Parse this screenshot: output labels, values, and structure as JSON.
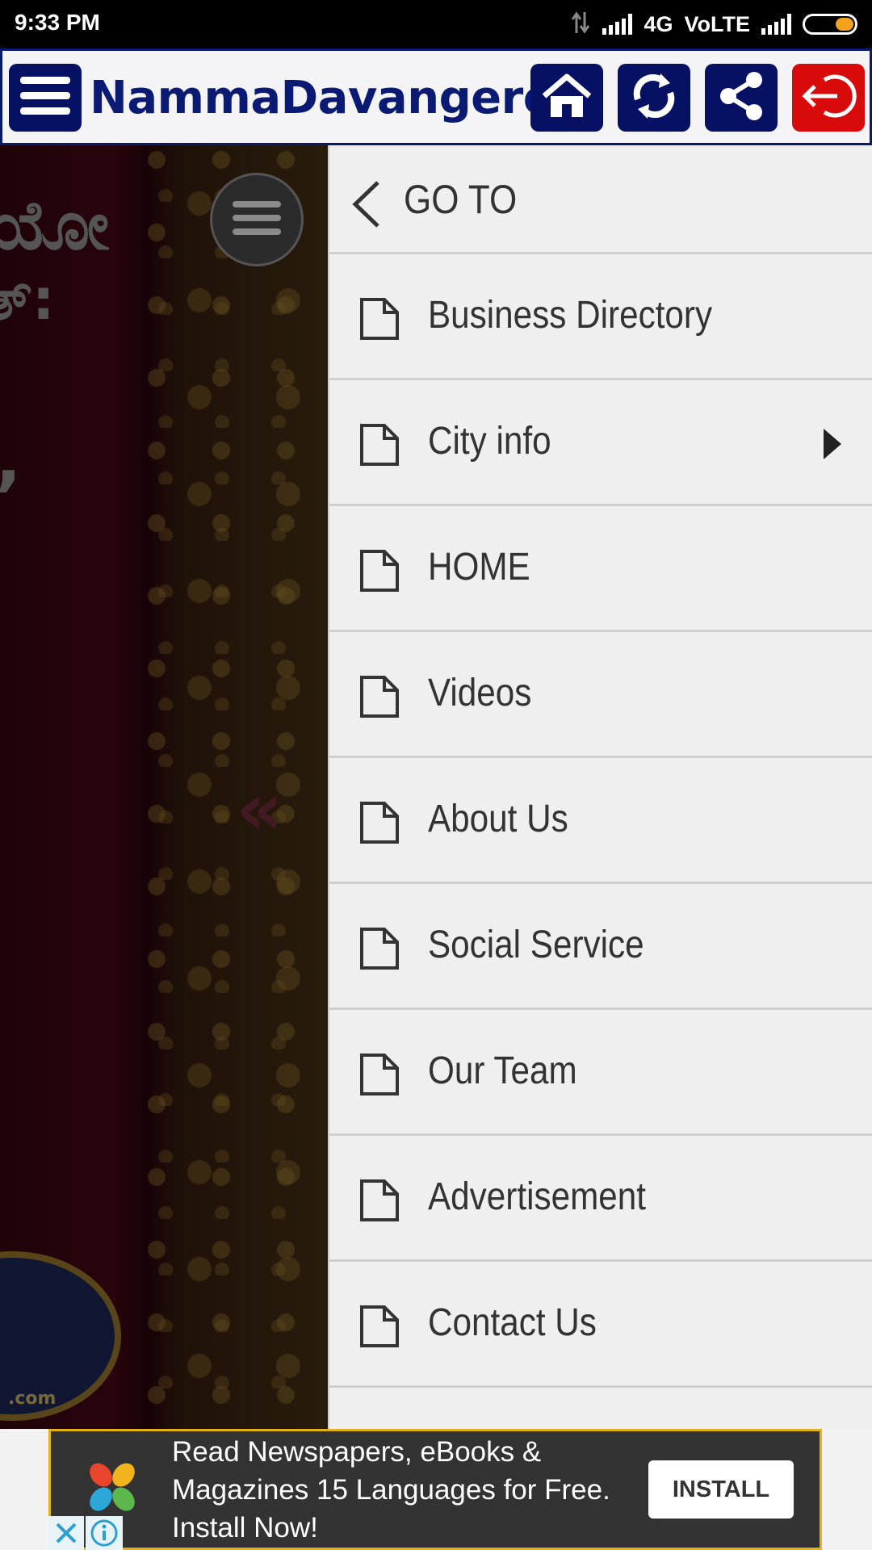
{
  "status_bar": {
    "time": "9:33 PM",
    "network": "4G",
    "volte": "VoLTE",
    "battery_color": "#f4a21c"
  },
  "header": {
    "title": "NammaDavangere",
    "menu_icon": "hamburger-icon",
    "buttons": [
      {
        "name": "home-button",
        "icon": "home-icon",
        "color": "#061163"
      },
      {
        "name": "refresh-button",
        "icon": "refresh-icon",
        "color": "#061163"
      },
      {
        "name": "share-button",
        "icon": "share-icon",
        "color": "#061163"
      },
      {
        "name": "logout-button",
        "icon": "logout-icon",
        "color": "#d80a0a"
      }
    ]
  },
  "drawer": {
    "title": "GO TO",
    "items": [
      {
        "label": "Business Directory",
        "has_submenu": false
      },
      {
        "label": "City info",
        "has_submenu": true
      },
      {
        "label": "HOME",
        "has_submenu": false
      },
      {
        "label": "Videos",
        "has_submenu": false
      },
      {
        "label": "About Us",
        "has_submenu": false
      },
      {
        "label": "Social Service",
        "has_submenu": false
      },
      {
        "label": "Our Team",
        "has_submenu": false
      },
      {
        "label": "Advertisement",
        "has_submenu": false
      },
      {
        "label": "Contact Us",
        "has_submenu": false
      }
    ]
  },
  "background_page": {
    "line1": "ಯೋ",
    "line2": "ತ್:",
    "line3": "ತ,",
    "logo_text": ".com"
  },
  "ad": {
    "text_line1": "Read Newspapers, eBooks &",
    "text_line2": "Magazines 15 Languages for Free.",
    "text_line3": "Install Now!",
    "install_label": "INSTALL",
    "border_color": "#e3b21a"
  }
}
